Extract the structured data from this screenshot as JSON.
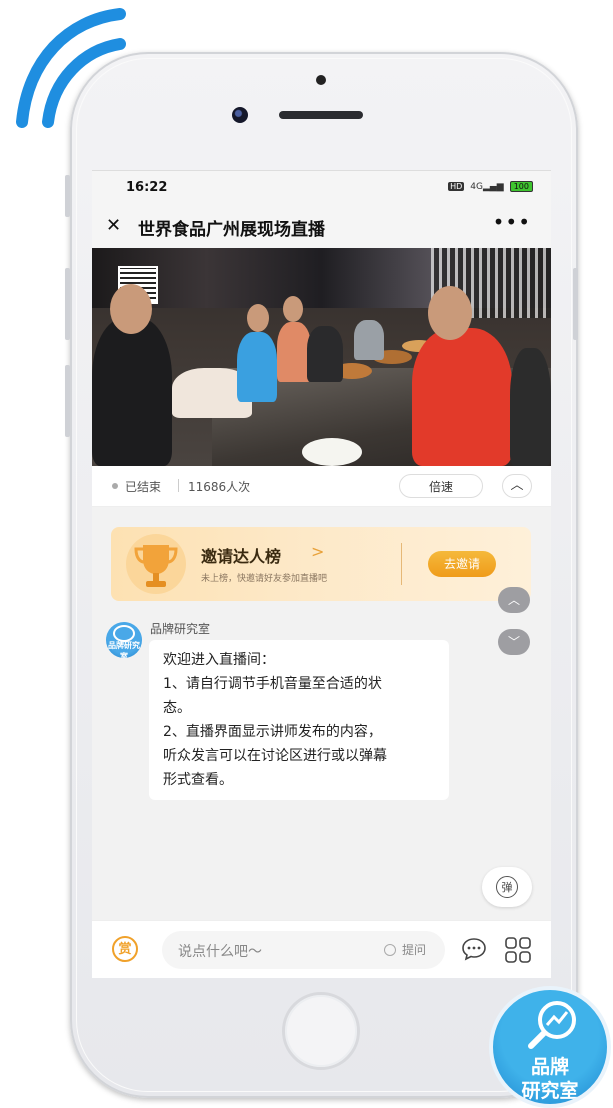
{
  "statusbar": {
    "time": "16:22",
    "hd": "HD",
    "network": "4G",
    "battery": "100"
  },
  "navbar": {
    "close": "✕",
    "title": "世界食品广州展现场直播",
    "more": "•••"
  },
  "live_info": {
    "status": "已结束",
    "viewers": "11686人次",
    "speed_label": "倍速",
    "collapse": "︿"
  },
  "invite": {
    "title": "邀请达人榜",
    "chevron": ">",
    "subtitle": "未上榜，快邀请好友参加直播吧",
    "button": "去邀请"
  },
  "scroll": {
    "up": "︿",
    "down": "﹀"
  },
  "message": {
    "sender": "品牌研究室",
    "avatar_text": "品牌研究室",
    "lines": [
      "欢迎进入直播间：",
      "1、请自行调节手机音量至合适的状",
      "态。",
      "2、直播界面显示讲师发布的内容，",
      "听众发言可以在讨论区进行或以弹幕",
      "形式查看。"
    ]
  },
  "danmu": {
    "label": "弹"
  },
  "bottom": {
    "reward": "赏",
    "placeholder": "说点什么吧～",
    "ask_label": "提问"
  },
  "badge": {
    "line1": "品牌",
    "line2": "研究室"
  },
  "colors": {
    "wifi": "#1f8ee0",
    "accent_orange": "#f0a12a",
    "brand_blue": "#2f9ee0"
  },
  "icons": [
    "wifi-icon",
    "close-icon",
    "more-icon",
    "trophy-icon",
    "chevron-up-icon",
    "chevron-down-icon",
    "danmu-icon",
    "reward-icon",
    "comment-icon",
    "menu-grid-icon",
    "magnifier-icon"
  ]
}
